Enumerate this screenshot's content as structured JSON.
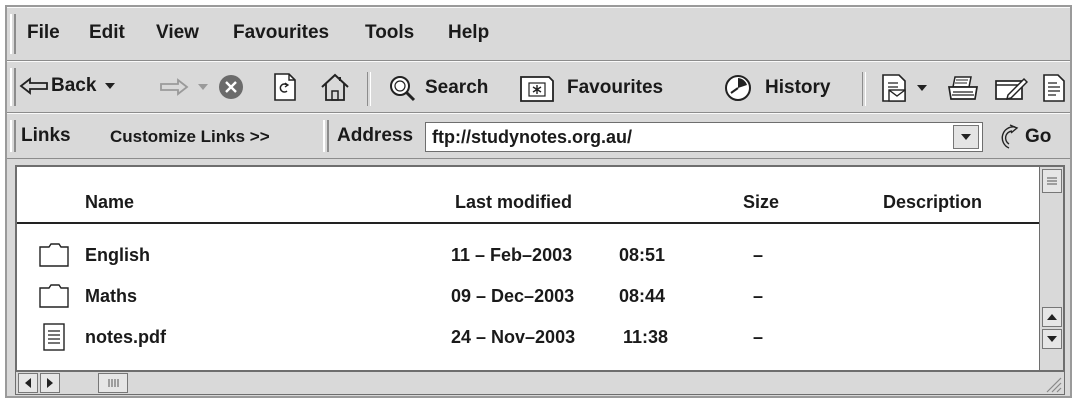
{
  "menu": [
    "File",
    "Edit",
    "View",
    "Favourites",
    "Tools",
    "Help"
  ],
  "toolbar": {
    "back_label": "Back",
    "search_label": "Search",
    "favourites_label": "Favourites",
    "history_label": "History"
  },
  "links_bar": {
    "links_label": "Links",
    "customize_label": "Customize Links >>",
    "address_label": "Address",
    "address_value": "ftp://studynotes.org.au/",
    "go_label": "Go"
  },
  "columns": {
    "name": "Name",
    "modified": "Last modified",
    "size": "Size",
    "description": "Description"
  },
  "files": [
    {
      "type": "folder",
      "name": "English",
      "date": "11 – Feb–2003",
      "time": "08:51",
      "size": "–",
      "description": ""
    },
    {
      "type": "folder",
      "name": "Maths",
      "date": "09 – Dec–2003",
      "time": "08:44",
      "size": "–",
      "description": ""
    },
    {
      "type": "document",
      "name": "notes.pdf",
      "date": "24 – Nov–2003",
      "time": "11:38",
      "size": "–",
      "description": ""
    }
  ]
}
